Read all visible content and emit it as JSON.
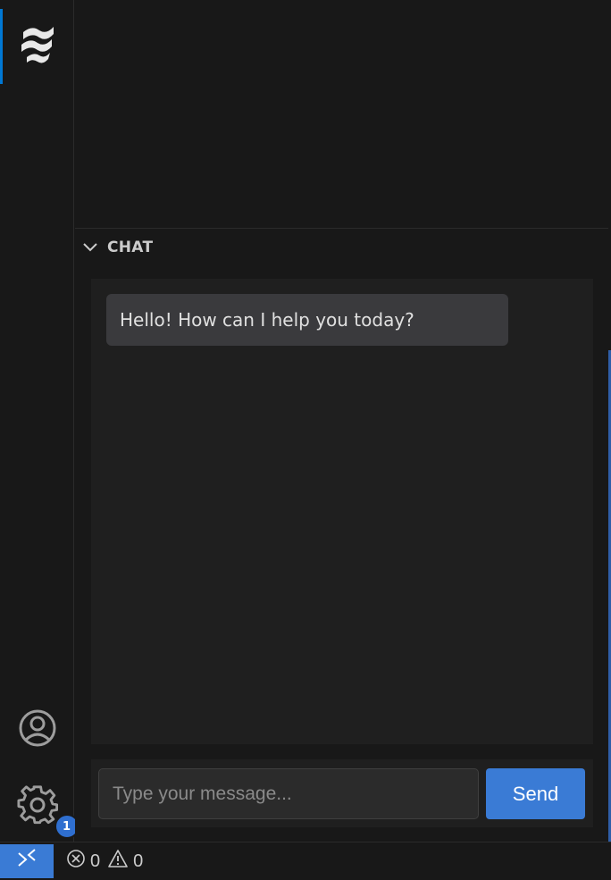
{
  "activity_bar": {
    "logo_icon": "windsurf-logo-icon",
    "account_icon": "account-icon",
    "settings_icon": "gear-icon",
    "settings_badge": "1"
  },
  "chat": {
    "section_title": "CHAT",
    "messages": [
      {
        "role": "assistant",
        "text": "Hello! How can I help you today?"
      }
    ],
    "input": {
      "placeholder": "Type your message...",
      "value": ""
    },
    "send_label": "Send"
  },
  "status_bar": {
    "remote_icon": "remote-icon",
    "errors": "0",
    "warnings": "0"
  },
  "colors": {
    "accent": "#3a7bd5",
    "background": "#181818",
    "panel": "#1f1f1f",
    "bubble": "#3a3a3d"
  }
}
